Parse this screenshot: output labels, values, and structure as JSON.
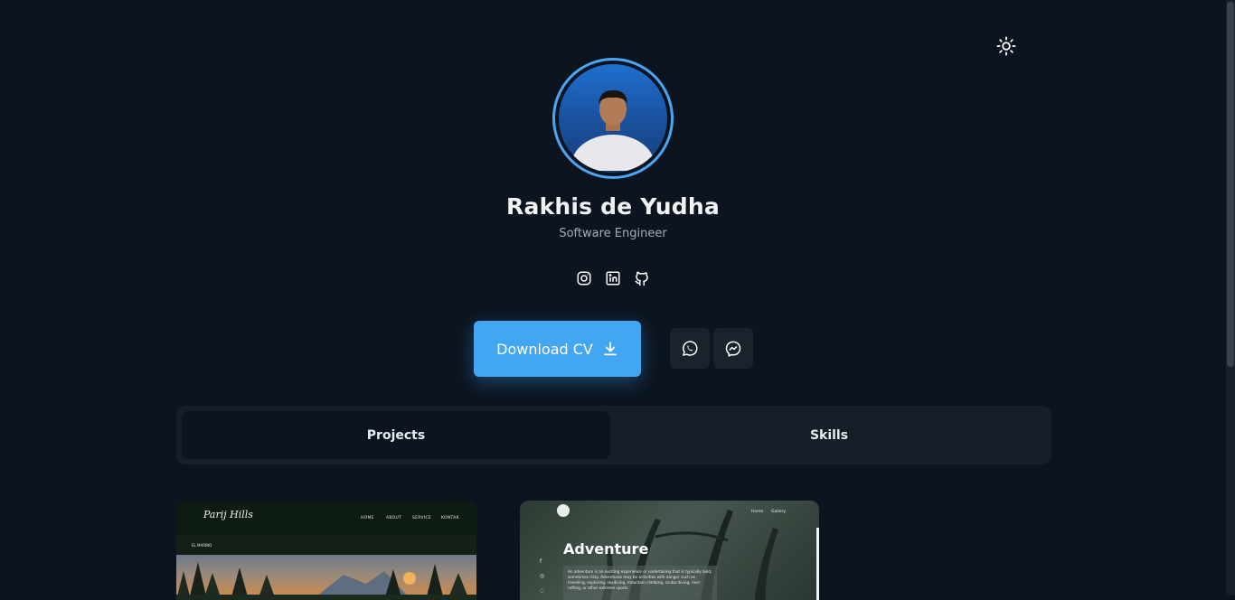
{
  "profile": {
    "name": "Rakhis de Yudha",
    "role": "Software Engineer"
  },
  "socials": [
    {
      "icon": "instagram-icon"
    },
    {
      "icon": "linkedin-icon"
    },
    {
      "icon": "github-icon"
    }
  ],
  "actions": {
    "download_cv_label": "Download CV",
    "contact_icons": [
      "whatsapp-icon",
      "messenger-icon"
    ]
  },
  "tabs": [
    {
      "label": "Projects",
      "active": true
    },
    {
      "label": "Skills",
      "active": false
    }
  ],
  "projects": [
    {
      "logo": "Parij Hills",
      "nav": [
        "HOME",
        "ABOUT",
        "SERVICE",
        "KONTAK"
      ],
      "subnav": [
        "EL MARINO",
        "",
        "",
        "",
        "",
        ""
      ]
    },
    {
      "title": "Adventure",
      "text": "An adventure is an exciting experience or undertaking that is typically bold, sometimes risky. Adventures may be activities with danger such as traveling, exploring, skydiving, mountain climbing, scuba diving, river rafting, or other extreme sports.",
      "nav": [
        "Home",
        "Gallery"
      ]
    }
  ],
  "colors": {
    "background": "#0c1420",
    "accent": "#43a6f3",
    "surface": "#161e28"
  }
}
